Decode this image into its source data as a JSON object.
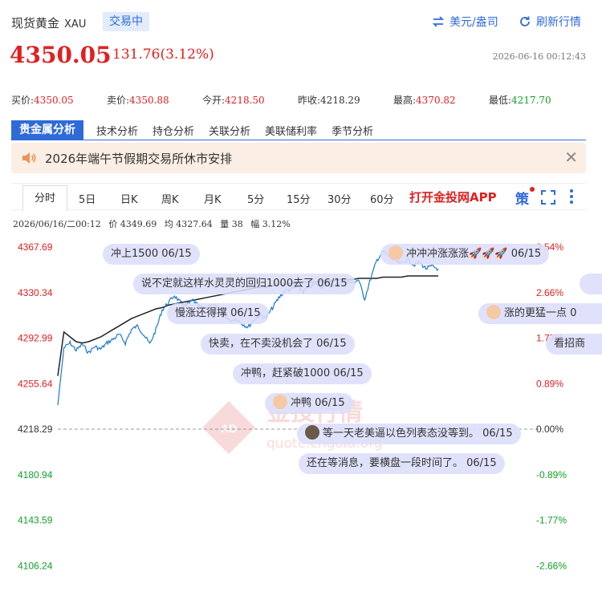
{
  "header": {
    "title": "现货黄金",
    "code": "XAU",
    "status_badge": "交易中",
    "currency_link": "美元/盎司",
    "refresh_link": "刷新行情"
  },
  "price": {
    "last": "4350.05",
    "change": "131.76(3.12%)",
    "timestamp": "2026-06-16 00:12:43"
  },
  "quotes": [
    {
      "label": "买价:",
      "value": "4350.05"
    },
    {
      "label": "卖价:",
      "value": "4350.88"
    },
    {
      "label": "今开:",
      "value": "4218.50"
    },
    {
      "label": "昨收:",
      "value": "4218.29"
    },
    {
      "label": "最高:",
      "value": "4370.82"
    },
    {
      "label": "最低:",
      "value": "4217.70"
    }
  ],
  "tabs": [
    "贵金属分析",
    "技术分析",
    "持仓分析",
    "关联分析",
    "美联储利率",
    "季节分析"
  ],
  "notice": {
    "text": "2026年端午节假期交易所休市安排",
    "close": "✕"
  },
  "periods": [
    "分时",
    "5日",
    "日K",
    "周K",
    "月K",
    "5分",
    "15分",
    "30分",
    "60分"
  ],
  "open_app": "打开金投网APP",
  "strategy_label": "策",
  "info_line": {
    "datetime": "2026/06/16/二00:12",
    "price": "价 4349.69",
    "avg": "均 4327.64",
    "vol": "量 38",
    "amp": "幅 3.12%"
  },
  "watermark": {
    "text": "金投行情",
    "sub": "quote.cngold.org",
    "logo": "AD"
  },
  "danmaku": [
    "冲上1500 06/15",
    "说不定就这样水灵灵的回归1000去了 06/15",
    "慢涨还得撑 06/15",
    "快卖，在不卖没机会了 06/15",
    "冲鸭，赶紧破1000 06/15",
    "冲鸭 06/15",
    "等一天老美逼以色列表态没等到。 06/15",
    "还在等消息，要横盘一段时间了。 06/15",
    "冲冲冲涨涨涨🚀🚀🚀 06/15",
    "涨的更猛一点 0",
    "看招商"
  ],
  "chart_data": {
    "type": "line",
    "prev_close": 4218.29,
    "ylim": [
      4087.59,
      4367.69
    ],
    "y_ticks_left": [
      "4367.69",
      "4330.34",
      "4292.99",
      "4255.64",
      "4218.29",
      "4180.94",
      "4143.59",
      "4106.24"
    ],
    "y_ticks_right": [
      "3.54%",
      "2.66%",
      "1.77%",
      "0.89%",
      "0.00%",
      "-0.89%",
      "-1.77%",
      "-2.66%"
    ],
    "colors": {
      "up": "#e02020",
      "zero": "#333333",
      "down": "#13a028",
      "price_line": "#1b78d0",
      "avg_line": "#222222"
    },
    "price_series": [
      4238,
      4285,
      4289,
      4283,
      4288,
      4281,
      4286,
      4284,
      4289,
      4292,
      4296,
      4289,
      4300,
      4303,
      4296,
      4288,
      4300,
      4316,
      4322,
      4328,
      4322,
      4320,
      4324,
      4319,
      4317,
      4321,
      4318,
      4313,
      4307,
      4309,
      4305,
      4302,
      4308,
      4312,
      4310,
      4318,
      4326,
      4332,
      4333,
      4336,
      4331,
      4335,
      4337,
      4335,
      4339,
      4336,
      4338,
      4340,
      4338,
      4341,
      4325,
      4342,
      4357,
      4364,
      4360,
      4356,
      4354,
      4358,
      4353,
      4355,
      4350,
      4352,
      4349.69
    ],
    "avg_series": [
      4262,
      4298,
      4294,
      4290,
      4289,
      4290,
      4292,
      4294,
      4297,
      4300,
      4303,
      4306,
      4309,
      4311,
      4313,
      4315,
      4317,
      4318,
      4320,
      4321,
      4322,
      4323,
      4324,
      4325,
      4326,
      4327,
      4328,
      4329,
      4330,
      4331,
      4332,
      4333,
      4334,
      4335,
      4335,
      4336,
      4337,
      4337,
      4338,
      4338,
      4339,
      4339,
      4339,
      4340,
      4340,
      4340,
      4341,
      4341,
      4341,
      4342,
      4342,
      4342,
      4342,
      4343,
      4343,
      4343,
      4343,
      4344,
      4344,
      4344,
      4344,
      4344,
      4344
    ]
  }
}
